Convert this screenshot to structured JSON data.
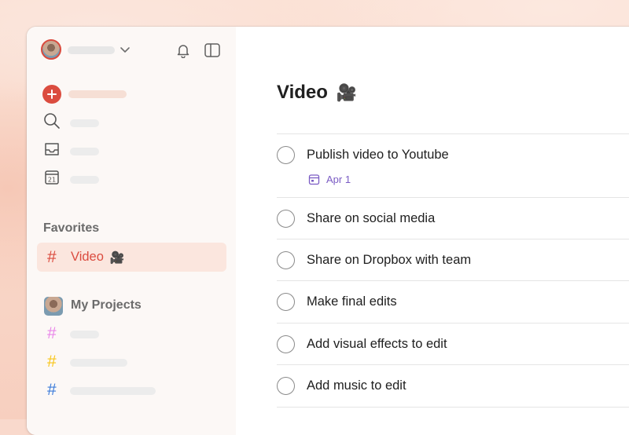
{
  "sidebar": {
    "favorites_title": "Favorites",
    "favorite_item": {
      "label": "Video",
      "emoji": "🎥",
      "hash": "#"
    },
    "projects_title": "My Projects",
    "project_hashes": [
      "#",
      "#",
      "#"
    ]
  },
  "colors": {
    "accent": "#db4c3f",
    "project_hash_colors": [
      "#e986e9",
      "#f8c61b",
      "#3c7bd9"
    ],
    "due_color": "#7b5cc4"
  },
  "main": {
    "title": "Video",
    "title_emoji": "🎥",
    "tasks": [
      {
        "label": "Publish video to Youtube",
        "due": "Apr 1"
      },
      {
        "label": "Share on social media"
      },
      {
        "label": "Share on Dropbox with team"
      },
      {
        "label": "Make final edits"
      },
      {
        "label": "Add visual effects to edit"
      },
      {
        "label": "Add music to edit"
      }
    ]
  }
}
